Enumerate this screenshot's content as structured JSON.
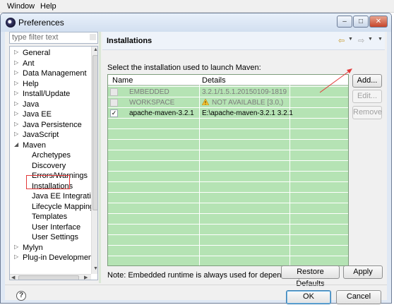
{
  "menubar": {
    "items": [
      "Window",
      "Help"
    ]
  },
  "window": {
    "title": "Preferences",
    "controls": {
      "minimize": "–",
      "maximize": "□",
      "close": "✕"
    }
  },
  "sidebar": {
    "filter_placeholder": "type filter text",
    "items": [
      {
        "label": "General",
        "arrow": "▷"
      },
      {
        "label": "Ant",
        "arrow": "▷"
      },
      {
        "label": "Data Management",
        "arrow": "▷"
      },
      {
        "label": "Help",
        "arrow": "▷"
      },
      {
        "label": "Install/Update",
        "arrow": "▷"
      },
      {
        "label": "Java",
        "arrow": "▷"
      },
      {
        "label": "Java EE",
        "arrow": "▷"
      },
      {
        "label": "Java Persistence",
        "arrow": "▷"
      },
      {
        "label": "JavaScript",
        "arrow": "▷"
      },
      {
        "label": "Maven",
        "arrow": "◢"
      },
      {
        "label": "Archetypes"
      },
      {
        "label": "Discovery"
      },
      {
        "label": "Errors/Warnings"
      },
      {
        "label": "Installations"
      },
      {
        "label": "Java EE Integration"
      },
      {
        "label": "Lifecycle Mapping"
      },
      {
        "label": "Templates"
      },
      {
        "label": "User Interface"
      },
      {
        "label": "User Settings"
      },
      {
        "label": "Mylyn",
        "arrow": "▷"
      },
      {
        "label": "Plug-in Development",
        "arrow": "▷"
      }
    ],
    "selected_index": 13
  },
  "page": {
    "title": "Installations",
    "nav": {
      "back": "⇦",
      "forward": "⇨",
      "dropdown": "▼",
      "menu": "▼"
    },
    "prompt": "Select the installation used to launch Maven:",
    "table": {
      "columns": [
        "Name",
        "Details"
      ],
      "rows": [
        {
          "checked": "",
          "name": "EMBEDDED",
          "details": "3.2.1/1.5.1.20150109-1819",
          "enabled": false
        },
        {
          "checked": "",
          "name": "WORKSPACE",
          "details": "NOT AVAILABLE [3.0,)",
          "enabled": false,
          "icon": "warning-icon"
        },
        {
          "checked": "✓",
          "name": "apache-maven-3.2.1",
          "details": "E:\\apache-maven-3.2.1 3.2.1",
          "enabled": true
        }
      ]
    },
    "buttons": {
      "add": "Add...",
      "edit": "Edit...",
      "remove": "Remove"
    },
    "note": "Note: Embedded runtime is always used for dependency resolution",
    "restore_defaults": "Restore Defaults",
    "apply": "Apply"
  },
  "footer": {
    "help": "?",
    "ok": "OK",
    "cancel": "Cancel"
  },
  "colors": {
    "table_bg": "#b5e3b4",
    "annotation": "#e23a3a",
    "header_bg": "#eef3fa"
  }
}
